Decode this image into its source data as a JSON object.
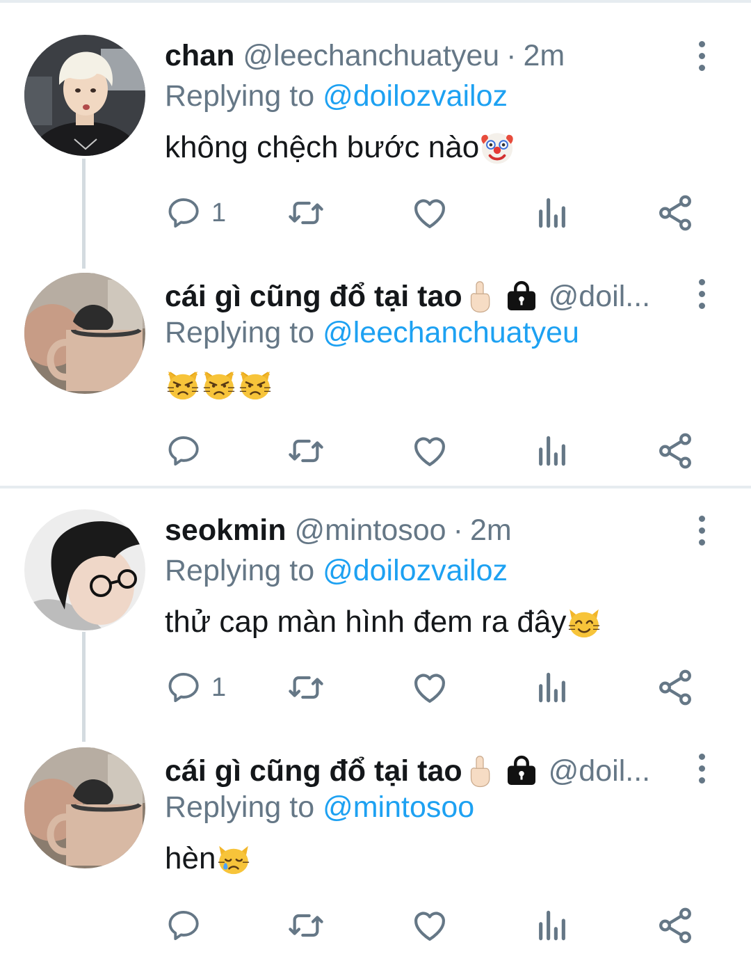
{
  "tweets": [
    {
      "name": "chan",
      "handle": "@leechanchuatyeu",
      "separator": "·",
      "time": "2m",
      "replying_prefix": "Replying to ",
      "replying_to": "@doilozvailoz",
      "text": "không chệch bước nào",
      "text_emoji": "clown-face",
      "reply_count": "1"
    },
    {
      "name": "cái gì cũng đổ tại tao",
      "name_emojis": [
        "index-pointing-up",
        "lock-bag"
      ],
      "handle": "@doil...",
      "replying_prefix": "Replying to ",
      "replying_to": "@leechanchuatyeu",
      "text": "",
      "text_emojis": [
        "pouting-cat",
        "pouting-cat",
        "pouting-cat"
      ],
      "reply_count": ""
    },
    {
      "name": "seokmin",
      "handle": "@mintosoo",
      "separator": "·",
      "time": "2m",
      "replying_prefix": "Replying to ",
      "replying_to": "@doilozvailoz",
      "text": "thử cap màn hình đem ra đây",
      "text_emoji": "smiling-cat",
      "reply_count": "1"
    },
    {
      "name": "cái gì cũng đổ tại tao",
      "name_emojis": [
        "index-pointing-up",
        "lock-bag"
      ],
      "handle": "@doil...",
      "replying_prefix": "Replying to ",
      "replying_to": "@mintosoo",
      "text": "hèn",
      "text_emoji": "crying-cat",
      "reply_count": ""
    }
  ],
  "action_icons": [
    "reply-icon",
    "retweet-icon",
    "like-icon",
    "analytics-icon",
    "share-icon"
  ],
  "colors": {
    "text": "#14171a",
    "muted": "#657786",
    "link": "#1da1f2",
    "divider": "#e6ecf0"
  }
}
